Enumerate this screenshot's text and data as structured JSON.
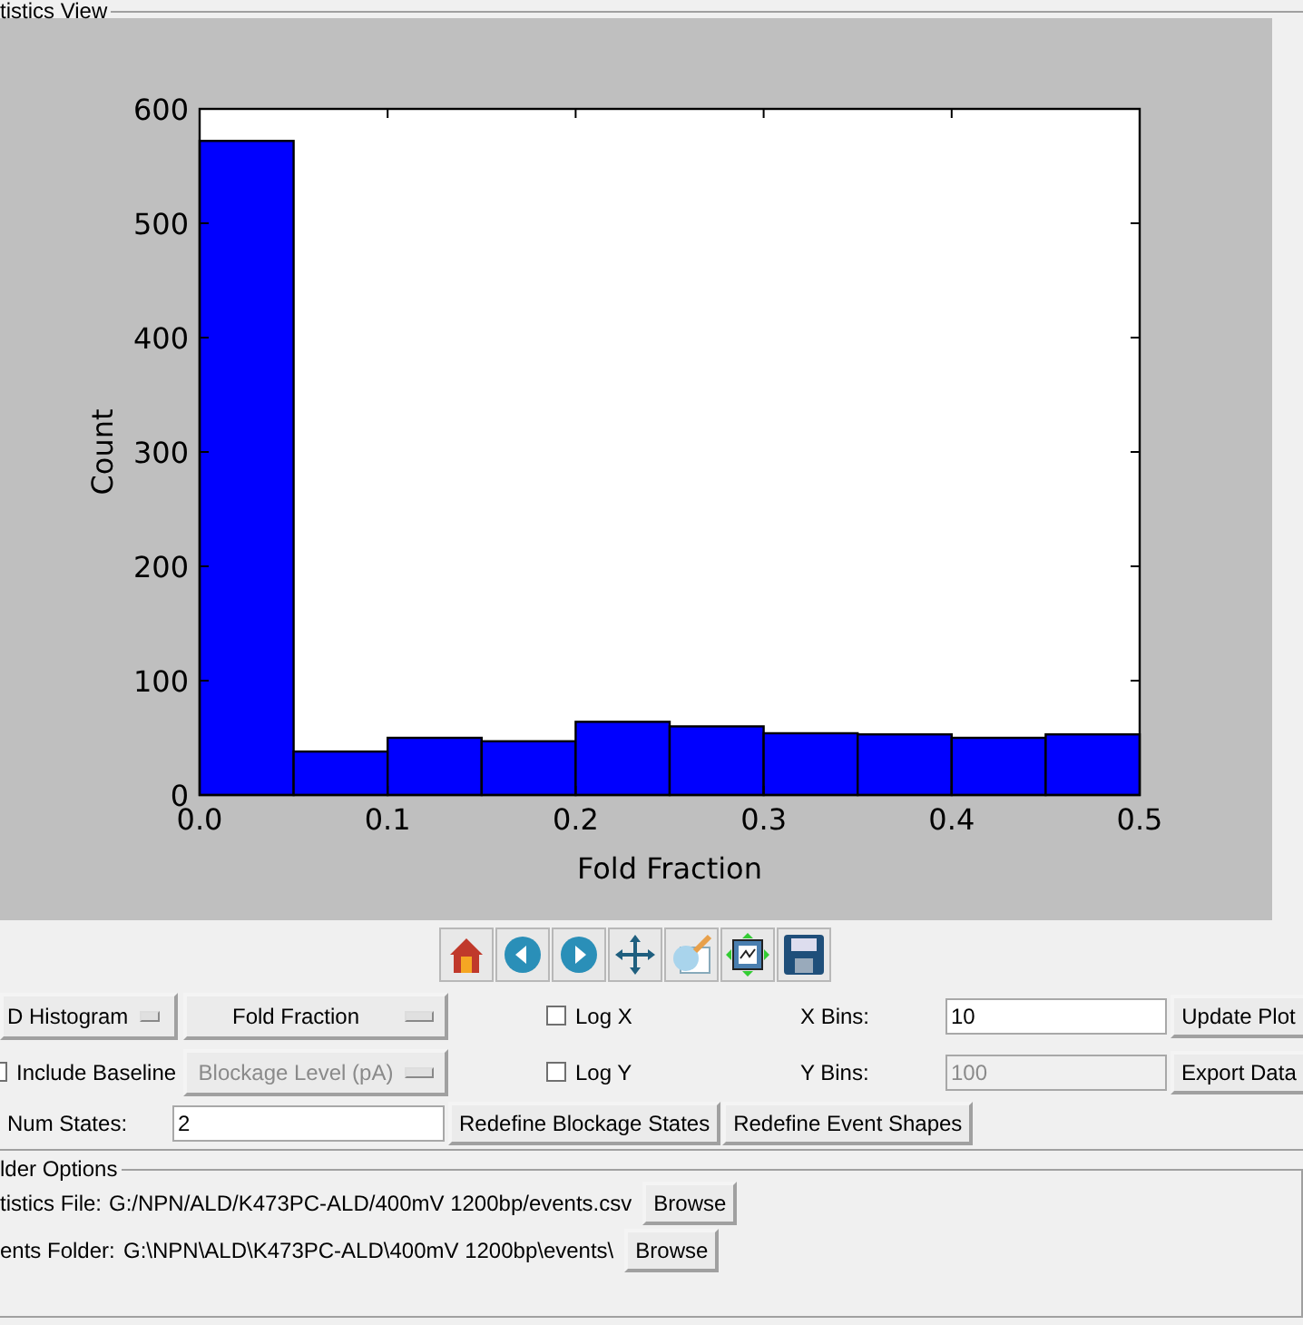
{
  "stats_view": {
    "title": "tistics View",
    "chart": {
      "chart_data": {
        "type": "bar",
        "xlabel": "Fold Fraction",
        "ylabel": "Count",
        "x": [
          0.025,
          0.075,
          0.125,
          0.175,
          0.225,
          0.275,
          0.325,
          0.375,
          0.425,
          0.475
        ],
        "series": [
          {
            "color": "#0000ff",
            "values": [
              572,
              38,
              50,
              47,
              64,
              60,
              54,
              53,
              50,
              53
            ]
          }
        ],
        "xlim": [
          0,
          0.5
        ],
        "ylim": [
          0,
          600
        ],
        "xticks": [
          {
            "value": 0,
            "label": "0.0"
          },
          {
            "value": 0.1,
            "label": "0.1"
          },
          {
            "value": 0.2,
            "label": "0.2"
          },
          {
            "value": 0.3,
            "label": "0.3"
          },
          {
            "value": 0.4,
            "label": "0.4"
          },
          {
            "value": 0.5,
            "label": "0.5"
          }
        ],
        "yticks": [
          0,
          100,
          200,
          300,
          400,
          500,
          600
        ]
      }
    },
    "toolbar": [
      {
        "kind": "home"
      },
      {
        "kind": "back"
      },
      {
        "kind": "forward"
      },
      {
        "kind": "pan"
      },
      {
        "kind": "edit"
      },
      {
        "kind": "fit"
      },
      {
        "kind": "save"
      }
    ],
    "plot_type": {
      "value": "D Histogram"
    },
    "x_param": {
      "value": "Fold Fraction"
    },
    "include_baseline": {
      "label": "Include Baseline",
      "checked": false
    },
    "y_param": {
      "value": "Blockage Level (pA)",
      "disabled": true
    },
    "log_x": {
      "label": "Log X",
      "checked": false
    },
    "log_y": {
      "label": "Log Y",
      "checked": false
    },
    "x_bins": {
      "label": "X Bins:",
      "value": "10",
      "disabled": false
    },
    "y_bins": {
      "label": "Y Bins:",
      "value": "100",
      "disabled": true
    },
    "update_button": "Update Plot",
    "export_button": "Export Data",
    "num_states": {
      "label": "Num States:",
      "value": "2"
    },
    "redefine_states_button": "Redefine Blockage States",
    "redefine_shapes_button": "Redefine Event Shapes"
  },
  "folder_options": {
    "title": "lder Options",
    "rows": [
      {
        "label": "tistics File:",
        "path": "G:/NPN/ALD/K473PC-ALD/400mV 1200bp/events.csv",
        "button": "Browse"
      },
      {
        "label": "ents Folder:",
        "path": "G:\\NPN\\ALD\\K473PC-ALD\\400mV 1200bp\\events\\",
        "button": "Browse"
      }
    ]
  }
}
